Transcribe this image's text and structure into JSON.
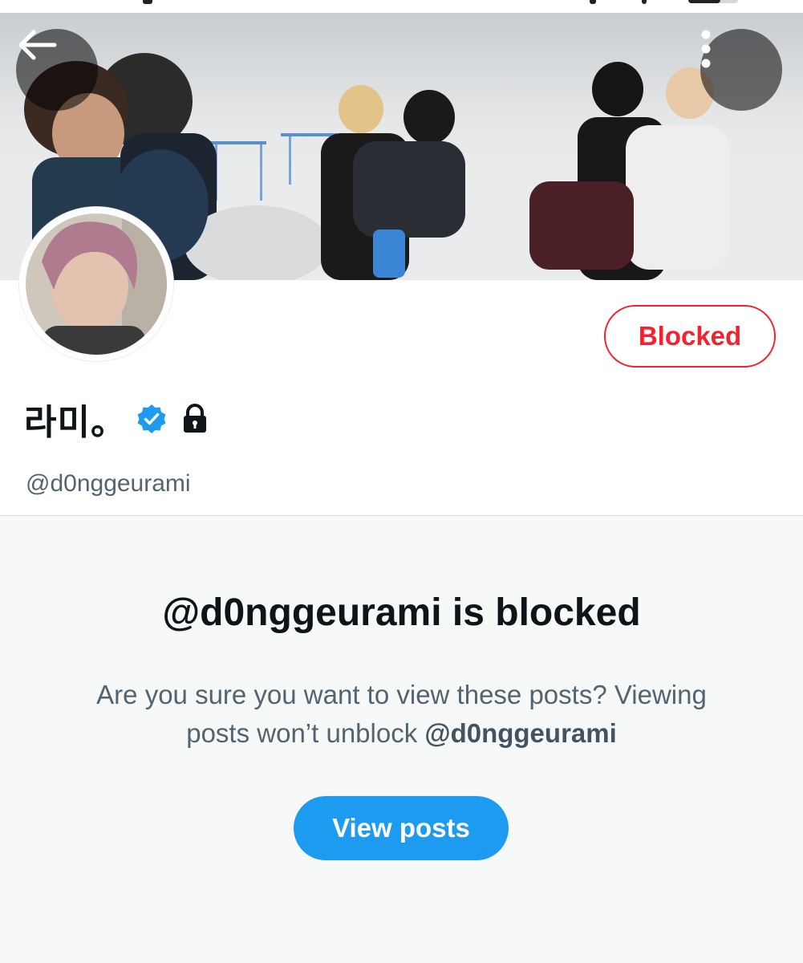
{
  "header": {
    "back_icon": "arrow-left-icon",
    "more_icon": "more-vertical-icon"
  },
  "profile": {
    "display_name": "라미。",
    "handle": "@d0nggeurami",
    "verified_icon": "verified-badge-icon",
    "protected_icon": "lock-icon",
    "blocked_label": "Blocked"
  },
  "blocked_notice": {
    "title": "@d0nggeurami is blocked",
    "description": "Are you sure you want to view these posts? Viewing posts won’t unblock",
    "description_handle": "@d0nggeurami",
    "view_posts_label": "View posts"
  },
  "colors": {
    "accent_blue": "#1d9bf0",
    "blocked_red": "#f4212e",
    "secondary_text": "#536471"
  }
}
